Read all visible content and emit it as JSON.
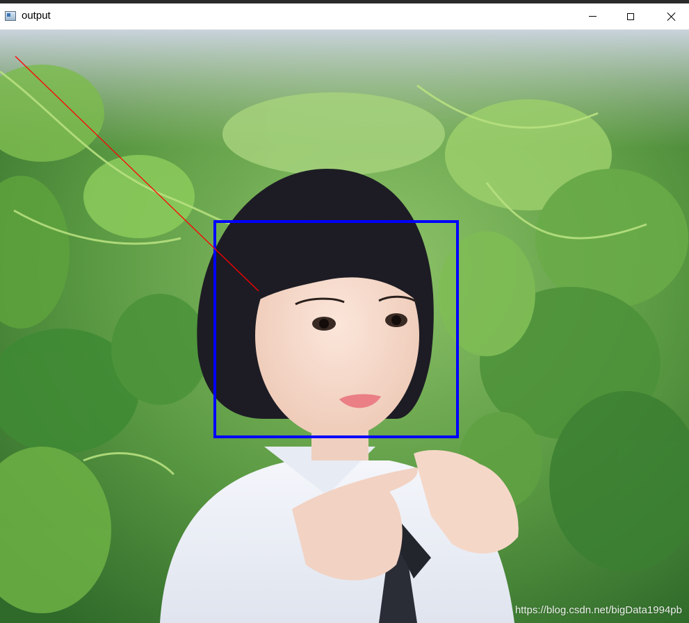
{
  "window": {
    "title": "output"
  },
  "image": {
    "description_icon": "photo-icon",
    "watermark": "https://blog.csdn.net/bigData1994pb"
  },
  "detection": {
    "box_color": "#0000ff",
    "line_color": "#ff0000"
  }
}
